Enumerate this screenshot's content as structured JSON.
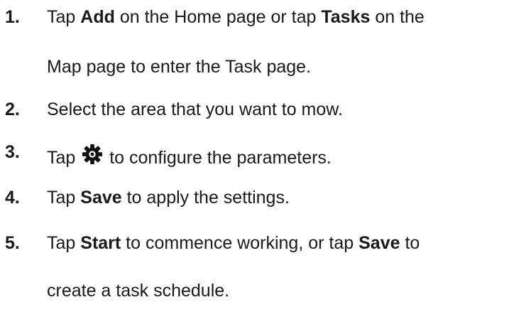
{
  "steps": [
    {
      "number": "1.",
      "parts": {
        "a": "Tap ",
        "b": "Add",
        "c": " on the Home page or tap ",
        "d": "Tasks",
        "e": " on the",
        "f": "Map page to enter the Task page."
      }
    },
    {
      "number": "2.",
      "text": "Select the area that you want to mow."
    },
    {
      "number": "3.",
      "parts": {
        "a": "Tap ",
        "icon": "gear-icon",
        "b": " to configure the parameters."
      }
    },
    {
      "number": "4.",
      "parts": {
        "a": "Tap ",
        "b": "Save",
        "c": " to apply the settings."
      }
    },
    {
      "number": "5.",
      "parts": {
        "a": "Tap ",
        "b": "Start",
        "c": " to commence working, or tap ",
        "d": "Save",
        "e": " to",
        "f": "create a task schedule."
      }
    }
  ]
}
